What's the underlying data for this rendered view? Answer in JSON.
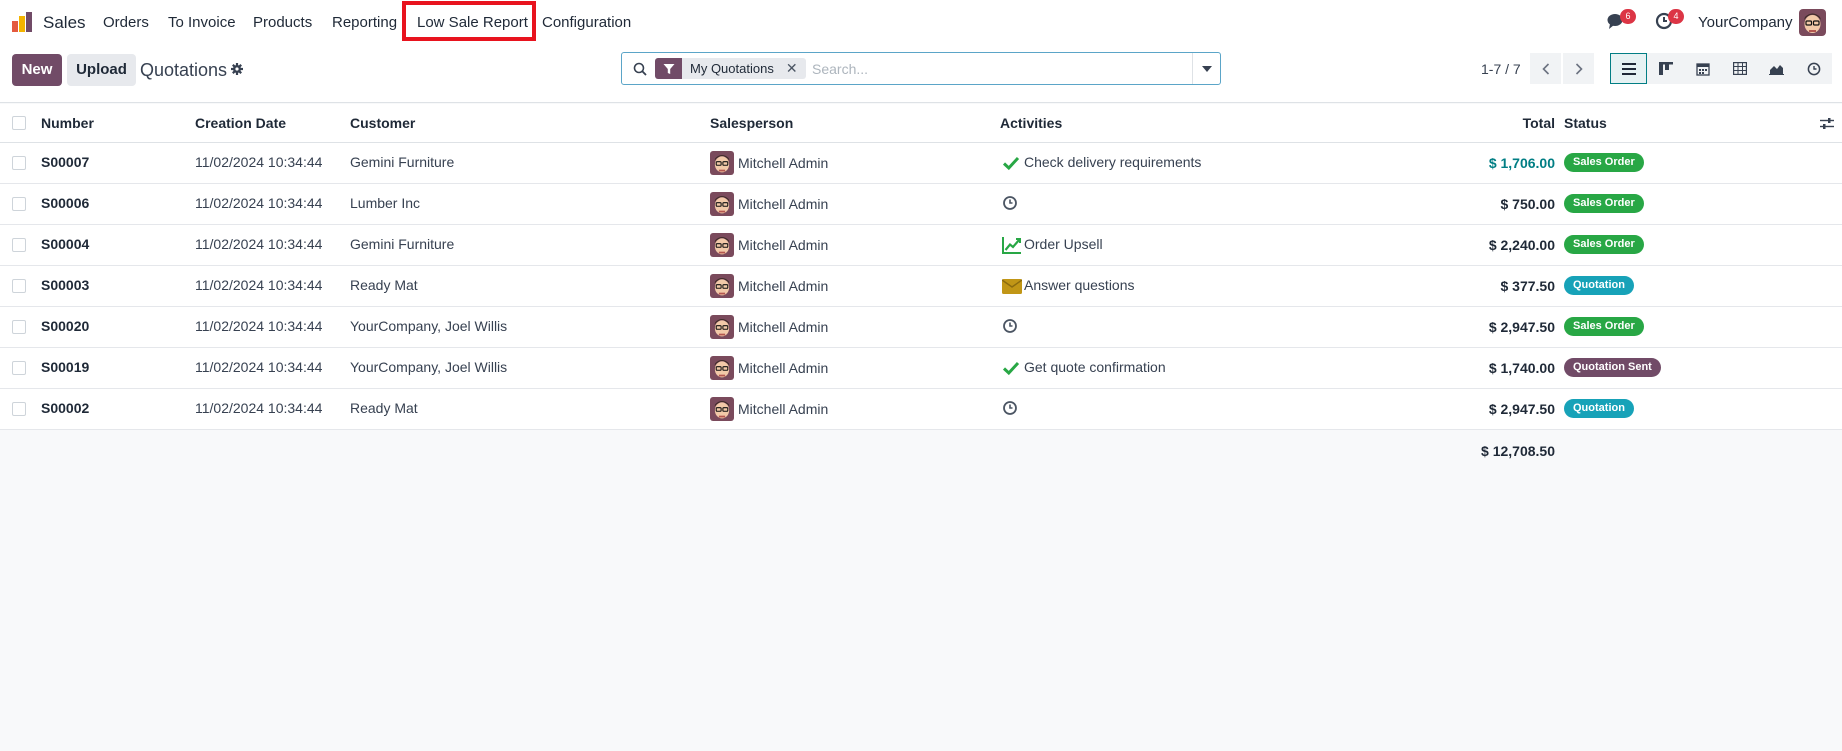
{
  "nav": {
    "app_name": "Sales",
    "items": [
      "Orders",
      "To Invoice",
      "Products",
      "Reporting",
      "Low Sale Report",
      "Configuration"
    ],
    "messages_badge": "6",
    "activities_badge": "4",
    "company": "YourCompany"
  },
  "control": {
    "new_label": "New",
    "upload_label": "Upload",
    "breadcrumb": "Quotations",
    "facet": "My Quotations",
    "search_placeholder": "Search...",
    "pager": "1-7 / 7"
  },
  "table": {
    "headers": {
      "number": "Number",
      "creation_date": "Creation Date",
      "customer": "Customer",
      "salesperson": "Salesperson",
      "activities": "Activities",
      "total": "Total",
      "status": "Status"
    },
    "rows": [
      {
        "number": "S00007",
        "date": "11/02/2024 10:34:44",
        "customer": "Gemini Furniture",
        "salesperson": "Mitchell Admin",
        "activity_icon": "check-icon",
        "activity": "Check delivery requirements",
        "total": "$ 1,706.00",
        "status": "Sales Order"
      },
      {
        "number": "S00006",
        "date": "11/02/2024 10:34:44",
        "customer": "Lumber Inc",
        "salesperson": "Mitchell Admin",
        "activity_icon": "clock-icon",
        "activity": "",
        "total": "$ 750.00",
        "status": "Sales Order"
      },
      {
        "number": "S00004",
        "date": "11/02/2024 10:34:44",
        "customer": "Gemini Furniture",
        "salesperson": "Mitchell Admin",
        "activity_icon": "chart-line-icon",
        "activity": "Order Upsell",
        "total": "$ 2,240.00",
        "status": "Sales Order"
      },
      {
        "number": "S00003",
        "date": "11/02/2024 10:34:44",
        "customer": "Ready Mat",
        "salesperson": "Mitchell Admin",
        "activity_icon": "envelope-icon",
        "activity": "Answer questions",
        "total": "$ 377.50",
        "status": "Quotation"
      },
      {
        "number": "S00020",
        "date": "11/02/2024 10:34:44",
        "customer": "YourCompany, Joel Willis",
        "salesperson": "Mitchell Admin",
        "activity_icon": "clock-icon",
        "activity": "",
        "total": "$ 2,947.50",
        "status": "Sales Order"
      },
      {
        "number": "S00019",
        "date": "11/02/2024 10:34:44",
        "customer": "YourCompany, Joel Willis",
        "salesperson": "Mitchell Admin",
        "activity_icon": "check-icon",
        "activity": "Get quote confirmation",
        "total": "$ 1,740.00",
        "status": "Quotation Sent"
      },
      {
        "number": "S00002",
        "date": "11/02/2024 10:34:44",
        "customer": "Ready Mat",
        "salesperson": "Mitchell Admin",
        "activity_icon": "clock-icon",
        "activity": "",
        "total": "$ 2,947.50",
        "status": "Quotation"
      }
    ],
    "sum_total": "$ 12,708.50"
  },
  "colors": {
    "brand": "#714b67",
    "highlight_box": "#e8131e",
    "status_sales_order": "#28a745",
    "status_quotation": "#17a2b8",
    "status_quotation_sent": "#714b67",
    "first_total": "#017e84"
  }
}
